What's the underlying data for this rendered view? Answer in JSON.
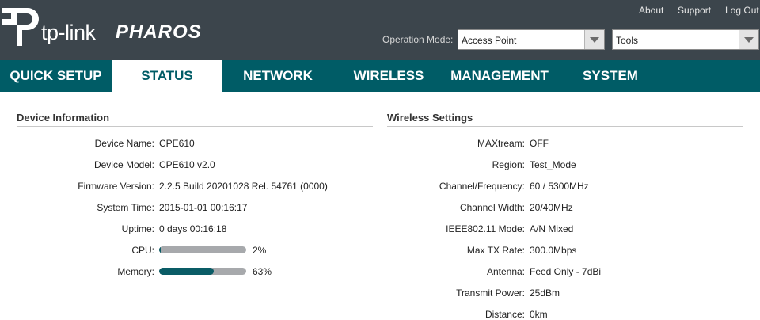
{
  "header": {
    "brand": "tp-link",
    "product": "PHAROS",
    "links": [
      "About",
      "Support",
      "Log Out"
    ],
    "operation_mode_label": "Operation Mode:",
    "operation_mode_value": "Access Point",
    "tools_value": "Tools"
  },
  "nav": {
    "tabs": [
      "QUICK SETUP",
      "STATUS",
      "NETWORK",
      "WIRELESS",
      "MANAGEMENT",
      "SYSTEM"
    ],
    "active": "STATUS"
  },
  "device_info": {
    "title": "Device Information",
    "rows": [
      {
        "label": "Device Name:",
        "value": "CPE610"
      },
      {
        "label": "Device Model:",
        "value": "CPE610 v2.0"
      },
      {
        "label": "Firmware Version:",
        "value": "2.2.5 Build 20201028 Rel. 54761 (0000)"
      },
      {
        "label": "System Time:",
        "value": "2015-01-01 00:16:17"
      },
      {
        "label": "Uptime:",
        "value": "0 days 00:16:18"
      }
    ],
    "cpu": {
      "label": "CPU:",
      "percent_text": "2%",
      "fraction": 0.02
    },
    "memory": {
      "label": "Memory:",
      "percent_text": "63%",
      "fraction": 0.63
    }
  },
  "wireless_settings": {
    "title": "Wireless Settings",
    "rows": [
      {
        "label": "MAXtream:",
        "value": "OFF"
      },
      {
        "label": "Region:",
        "value": "Test_Mode"
      },
      {
        "label": "Channel/Frequency:",
        "value": "60 / 5300MHz"
      },
      {
        "label": "Channel Width:",
        "value": "20/40MHz"
      },
      {
        "label": "IEEE802.11 Mode:",
        "value": "A/N Mixed"
      },
      {
        "label": "Max TX Rate:",
        "value": "300.0Mbps"
      },
      {
        "label": "Antenna:",
        "value": "Feed Only - 7dBi"
      },
      {
        "label": "Transmit Power:",
        "value": "25dBm"
      },
      {
        "label": "Distance:",
        "value": "0km"
      }
    ]
  },
  "colors": {
    "header_bg": "#3c454c",
    "nav_bg": "#005c66",
    "bar_fill": "#0a5c66"
  }
}
